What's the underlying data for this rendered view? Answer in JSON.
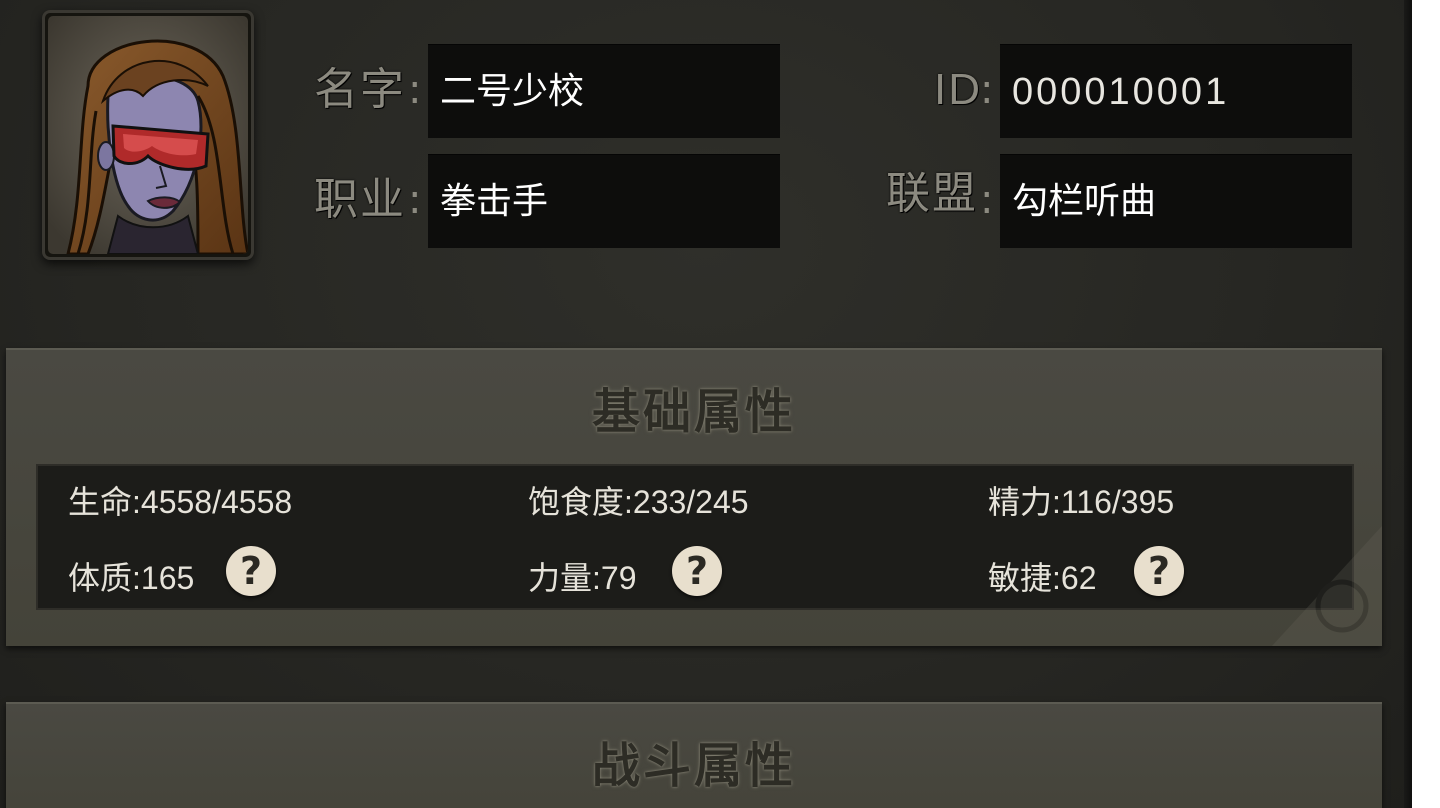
{
  "profile": {
    "name_label": "名字",
    "name_value": "二号少校",
    "id_label": "ID",
    "id_value": "000010001",
    "class_label": "职业",
    "class_value": "拳击手",
    "alliance_label": "联盟",
    "alliance_value": "勾栏听曲"
  },
  "basic_attributes": {
    "title": "基础属性",
    "life": "生命:4558/4558",
    "satiety": "饱食度:233/245",
    "energy": "精力:116/395",
    "constitution": "体质:165",
    "strength": "力量:79",
    "agility": "敏捷:62",
    "help_symbol": "?"
  },
  "combat_attributes": {
    "title": "战斗属性"
  },
  "icons": {
    "help": "question-mark-icon",
    "portrait": "character-portrait"
  },
  "colors": {
    "background": "#2a2a26",
    "panel": "#4a4942",
    "field": "#0d0d0c",
    "label": "#8c8a80",
    "help_button": "#e8dfcd"
  }
}
